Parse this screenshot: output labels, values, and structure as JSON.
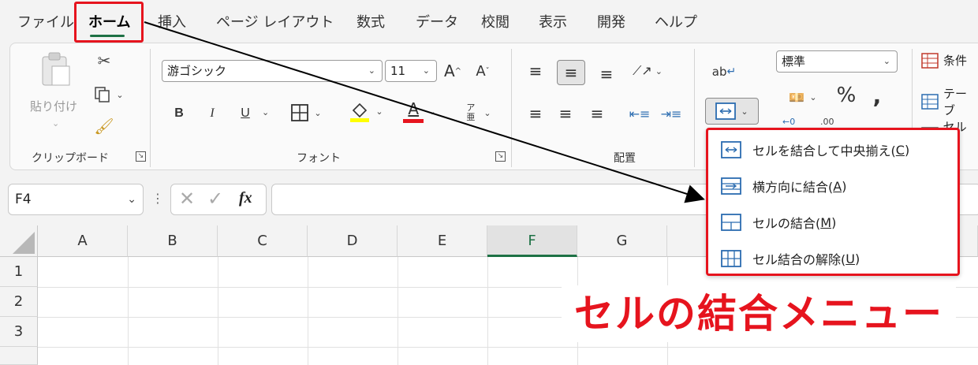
{
  "tabs": [
    {
      "label": "ファイル"
    },
    {
      "label": "ホーム"
    },
    {
      "label": "挿入"
    },
    {
      "label": "ページ レイアウト"
    },
    {
      "label": "数式"
    },
    {
      "label": "データ"
    },
    {
      "label": "校閲"
    },
    {
      "label": "表示"
    },
    {
      "label": "開発"
    },
    {
      "label": "ヘルプ"
    }
  ],
  "clipboard": {
    "paste_label": "貼り付け",
    "group_label": "クリップボード"
  },
  "font": {
    "name": "游ゴシック",
    "size": "11",
    "bold": "B",
    "italic": "I",
    "underline": "U",
    "font_color_glyph": "A",
    "grow_glyph": "A",
    "shrink_glyph": "A",
    "phonetic_glyph": "ア亜",
    "group_label": "フォント"
  },
  "alignment": {
    "group_label": "配置",
    "wrap_glyph": "ab"
  },
  "number": {
    "format": "標準",
    "percent": "%",
    "comma": ",",
    "decimal_inc": "←0",
    "decimal_dec": ".00"
  },
  "styles": {
    "conditional": "条件",
    "table": "テーブ",
    "cell": "セルの"
  },
  "formula_bar": {
    "name_box": "F4",
    "fx": "fx"
  },
  "columns": [
    "A",
    "B",
    "C",
    "D",
    "E",
    "F",
    "G"
  ],
  "rows": [
    "1",
    "2",
    "3"
  ],
  "merge_menu": {
    "items": [
      {
        "label": "セルを結合して中央揃え(",
        "key": "C",
        "suffix": ")",
        "icon": "merge-center-icon"
      },
      {
        "label": "横方向に結合(",
        "key": "A",
        "suffix": ")",
        "icon": "merge-across-icon"
      },
      {
        "label": "セルの結合(",
        "key": "M",
        "suffix": ")",
        "icon": "merge-cells-icon"
      },
      {
        "label": "セル結合の解除(",
        "key": "U",
        "suffix": ")",
        "icon": "unmerge-icon"
      }
    ]
  },
  "annotation": {
    "caption": "セルの結合メニュー",
    "accent": "#e6141e"
  },
  "colors": {
    "excel_green": "#1e7145",
    "highlight_yellow": "#ffff00",
    "font_red": "#e6141e"
  }
}
